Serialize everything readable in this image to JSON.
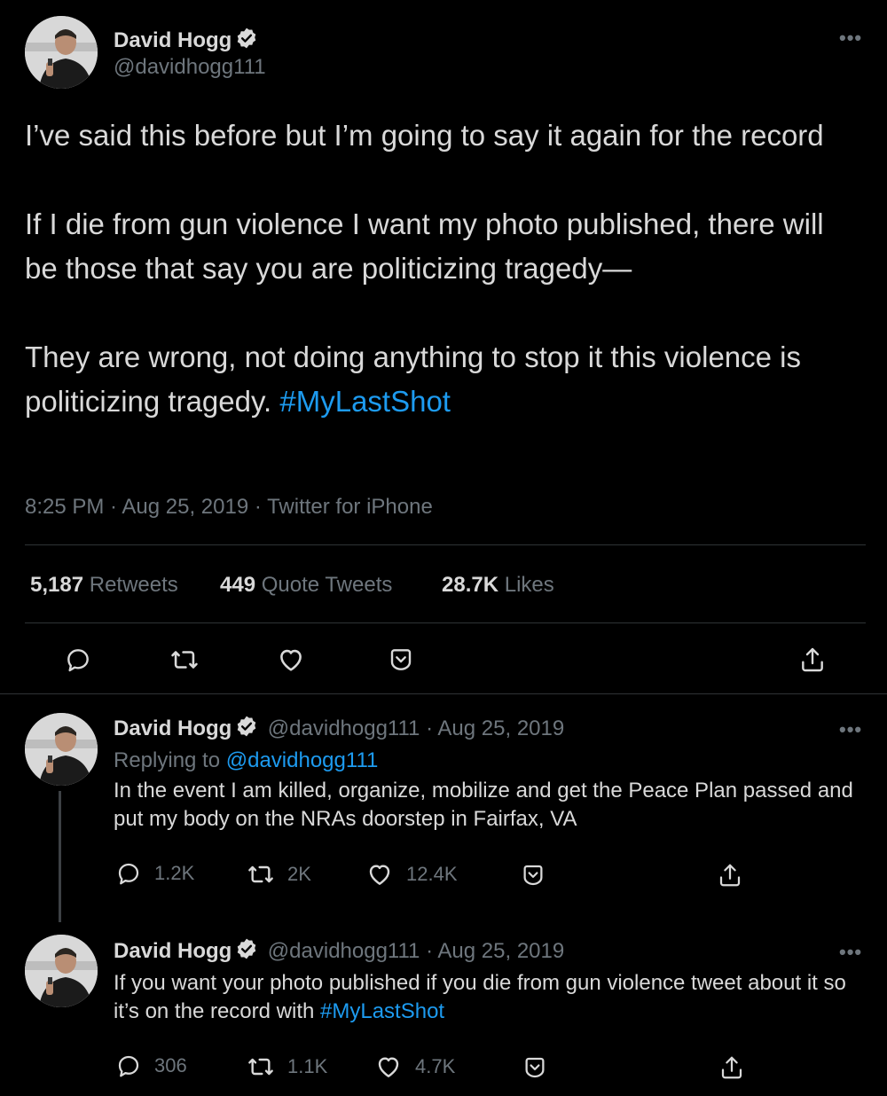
{
  "main_tweet": {
    "author_name": "David Hogg",
    "author_handle": "@davidhogg111",
    "text_p1": "I’ve said this before but I’m going to say it again for the record",
    "text_p2": "If I die from gun violence I want my photo published, there will be those that say you are politicizing tragedy—",
    "text_p3": "They are wrong, not doing anything to stop it this violence is politicizing tragedy.",
    "hashtag": "#MyLastShot",
    "timestamp": "8:25 PM · Aug 25, 2019 · Twitter for iPhone",
    "retweets_count": "5,187",
    "retweets_label": "Retweets",
    "quotes_count": "449",
    "quotes_label": "Quote Tweets",
    "likes_count": "28.7K",
    "likes_label": "Likes"
  },
  "reply_1": {
    "author_name": "David Hogg",
    "handle_date": "@davidhogg111 · Aug 25, 2019",
    "replying_label": "Replying to",
    "replying_handle": "@davidhogg111",
    "text": "In the event I am killed, organize, mobilize and get the Peace Plan passed and put my body on the NRAs doorstep in Fairfax, VA",
    "replies": "1.2K",
    "retweets": "2K",
    "likes": "12.4K"
  },
  "reply_2": {
    "author_name": "David Hogg",
    "handle_date": "@davidhogg111 · Aug 25, 2019",
    "text": "If you want your photo published if you die from gun violence tweet about it so it’s on the record with",
    "hashtag": "#MyLastShot",
    "replies": "306",
    "retweets": "1.1K",
    "likes": "4.7K"
  },
  "more_label": "•••",
  "colors": {
    "background": "#000000",
    "text": "#d9d9d9",
    "secondary": "#6e767d",
    "link": "#1d9bf0",
    "divider": "#2f3336"
  },
  "icons": [
    "verified-badge-icon",
    "more-icon",
    "reply-icon",
    "retweet-icon",
    "like-icon",
    "bookmark-icon",
    "share-icon"
  ]
}
